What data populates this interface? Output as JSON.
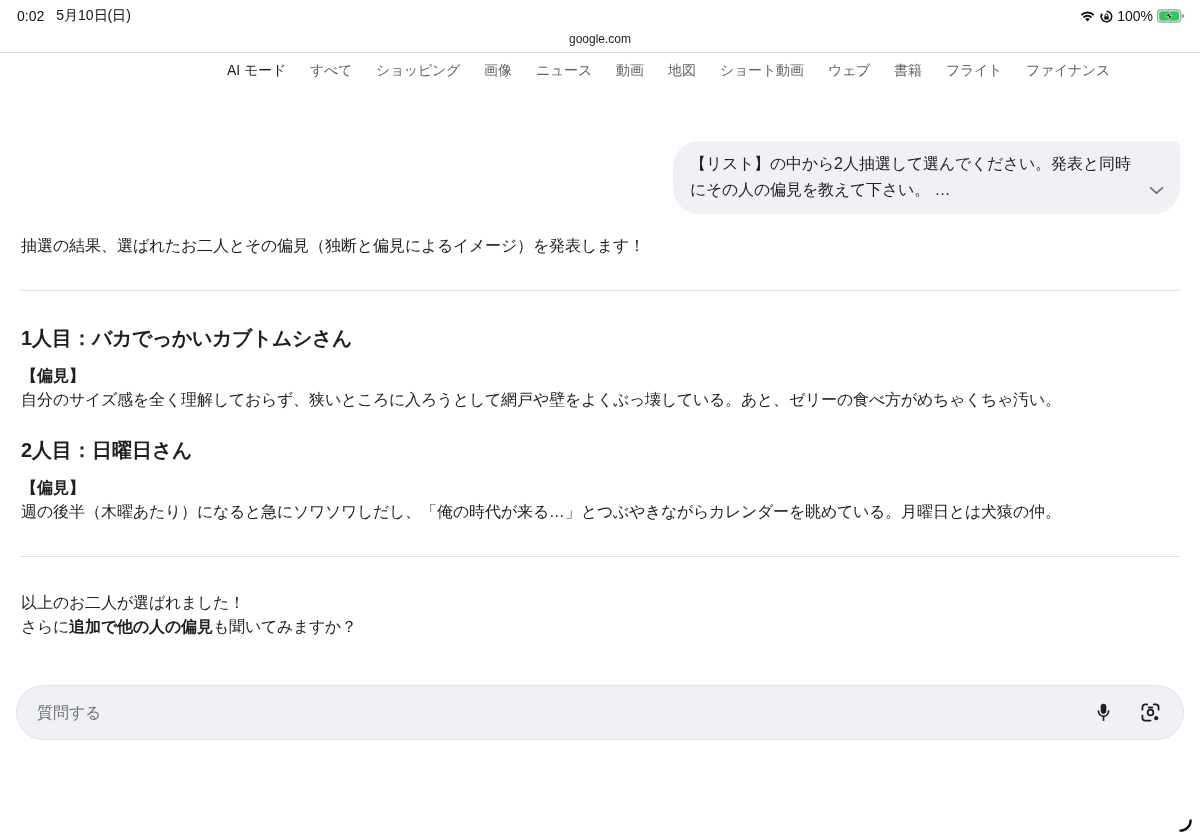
{
  "status_bar": {
    "time": "0:02",
    "date": "5月10日(日)",
    "battery_percent": "100%",
    "charging": true
  },
  "address_bar": {
    "url": "google.com"
  },
  "tabs": [
    {
      "label": "AI モード",
      "selected": true
    },
    {
      "label": "すべて",
      "selected": false
    },
    {
      "label": "ショッピング",
      "selected": false
    },
    {
      "label": "画像",
      "selected": false
    },
    {
      "label": "ニュース",
      "selected": false
    },
    {
      "label": "動画",
      "selected": false
    },
    {
      "label": "地図",
      "selected": false
    },
    {
      "label": "ショート動画",
      "selected": false
    },
    {
      "label": "ウェブ",
      "selected": false
    },
    {
      "label": "書籍",
      "selected": false
    },
    {
      "label": "フライト",
      "selected": false
    },
    {
      "label": "ファイナンス",
      "selected": false
    }
  ],
  "user_message": {
    "text": "【リスト】の中から2人抽選して選んでください。発表と同時にその人の偏見を教えて下さい。 …",
    "expanded": false
  },
  "response": {
    "intro": "抽選の結果、選ばれたお二人とその偏見（独断と偏見によるイメージ）を発表します！",
    "people": [
      {
        "heading": "1人目：バカでっかいカブトムシさん",
        "label": "【偏見】",
        "description": "自分のサイズ感を全く理解しておらず、狭いところに入ろうとして網戸や壁をよくぶっ壊している。あと、ゼリーの食べ方がめちゃくちゃ汚い。"
      },
      {
        "heading": "2人目：日曜日さん",
        "label": "【偏見】",
        "description": "週の後半（木曜あたり）になると急にソワソワしだし、「俺の時代が来る…」とつぶやきながらカレンダーを眺めている。月曜日とは犬猿の仲。"
      }
    ],
    "closing": [
      "以上のお二人が選ばれました！",
      "さらに**追加で他の人の偏見**も聞いてみますか？"
    ]
  },
  "input": {
    "placeholder": "質問する"
  }
}
